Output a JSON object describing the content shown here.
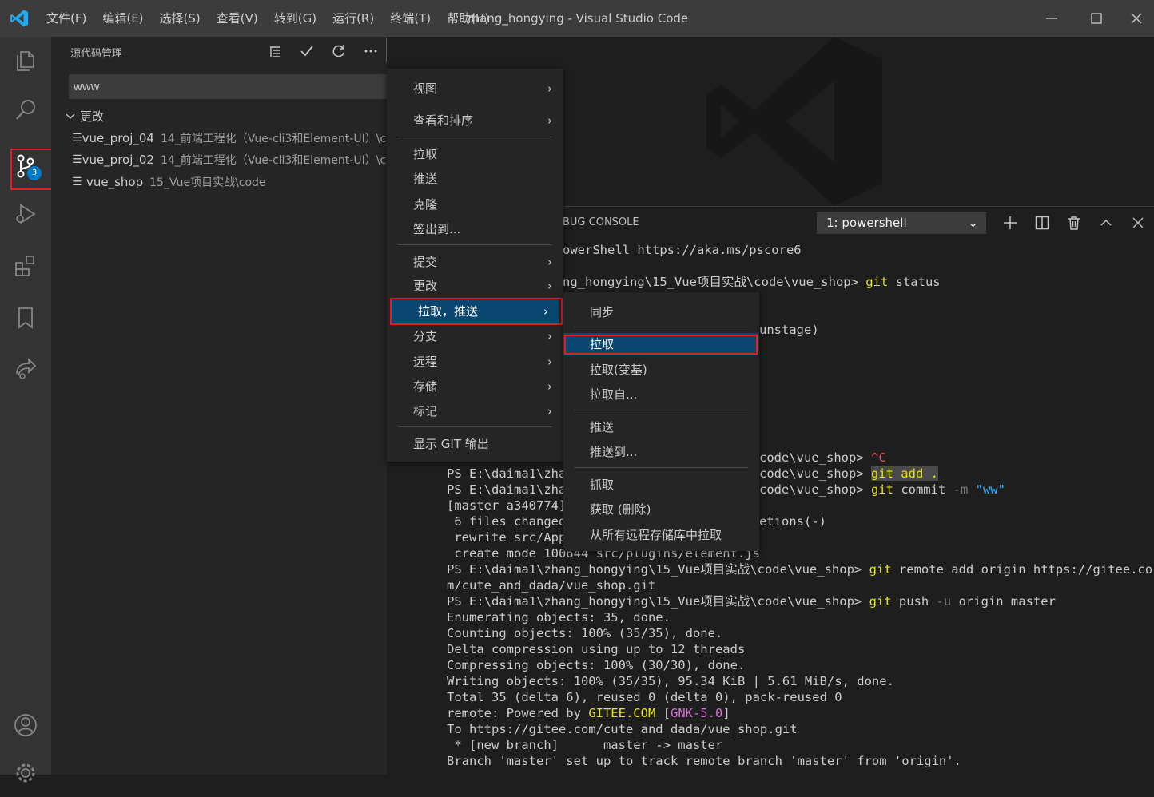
{
  "window": {
    "title": "zhang_hongying - Visual Studio Code",
    "menus": [
      "文件(F)",
      "编辑(E)",
      "选择(S)",
      "查看(V)",
      "转到(G)",
      "运行(R)",
      "终端(T)",
      "帮助(H)"
    ]
  },
  "activity": {
    "scm_badge": "3"
  },
  "sidebar": {
    "title": "源代码管理",
    "commit_message": "www",
    "changes_label": "更改",
    "files": [
      {
        "name": "vue_proj_04",
        "path": "14_前端工程化（Vue-cli3和Element-UI）\\c..."
      },
      {
        "name": "vue_proj_02",
        "path": "14_前端工程化（Vue-cli3和Element-UI）\\c..."
      },
      {
        "name": "vue_shop",
        "path": "15_Vue项目实战\\code"
      }
    ]
  },
  "panel": {
    "tab_label": "BUG CONSOLE",
    "terminal_select": "1: powershell"
  },
  "main_menu": {
    "items": [
      "视图",
      "查看和排序",
      "拉取",
      "推送",
      "克隆",
      "签出到...",
      "提交",
      "更改",
      "拉取，推送",
      "分支",
      "远程",
      "存储",
      "标记",
      "显示 GIT 输出"
    ]
  },
  "sub_menu": {
    "items": [
      "同步",
      "拉取",
      "拉取(变基)",
      "拉取自...",
      "推送",
      "推送到...",
      "抓取",
      "获取 (删除)",
      "从所有远程存储库中拉取"
    ]
  },
  "terminal": {
    "l1": "owerShell https://aka.ms/pscore6",
    "l2_prefix": "ng_hongying\\15_Vue项目实战\\code\\vue_shop> ",
    "l2_cmd": "git",
    "l2_rest": " status",
    "l3": "unstage)",
    "l4_prefix": "code\\vue_shop> ",
    "l4_ctrl": "^C",
    "l5a": "PS E:\\daima1\\zhan",
    "l5_prefix": "code\\vue_shop> ",
    "l5_cmd": "git add .",
    "l6a": "PS E:\\daima1\\zhan",
    "l6_prefix": "code\\vue_shop> ",
    "l6_cmd": "git",
    "l6_mid": " commit ",
    "l6_flag": "-m",
    "l6_str": " \"ww\"",
    "l7a": "[master a340774]",
    "l8a": " 6 files changed",
    "l8b": "etions(-)",
    "l9a": " rewrite src/App",
    "l10": " create mode 100644 src/plugins/element.js",
    "l11_prefix": "PS E:\\daima1\\zhang_hongying\\15_Vue项目实战\\code\\vue_shop> ",
    "l11_cmd": "git",
    "l11_rest": " remote add origin https://gitee.co",
    "l12": "m/cute_and_dada/vue_shop.git",
    "l13_prefix": "PS E:\\daima1\\zhang_hongying\\15_Vue项目实战\\code\\vue_shop> ",
    "l13_cmd": "git",
    "l13_mid": " push ",
    "l13_flag": "-u",
    "l13_rest": " origin master",
    "l14": "Enumerating objects: 35, done.",
    "l15": "Counting objects: 100% (35/35), done.",
    "l16": "Delta compression using up to 12 threads",
    "l17": "Compressing objects: 100% (30/30), done.",
    "l18": "Writing objects: 100% (35/35), 95.34 KiB | 5.61 MiB/s, done.",
    "l19": "Total 35 (delta 6), reused 0 (delta 0), pack-reused 0",
    "l20_prefix": "remote: Powered by ",
    "l20_gitee": "GITEE.COM",
    "l20_sp": " [",
    "l20_gnk": "GNK-5.0",
    "l20_end": "]",
    "l21": "To https://gitee.com/cute_and_dada/vue_shop.git",
    "l22": " * [new branch]      master -> master",
    "l23": "Branch 'master' set up to track remote branch 'master' from 'origin'."
  }
}
